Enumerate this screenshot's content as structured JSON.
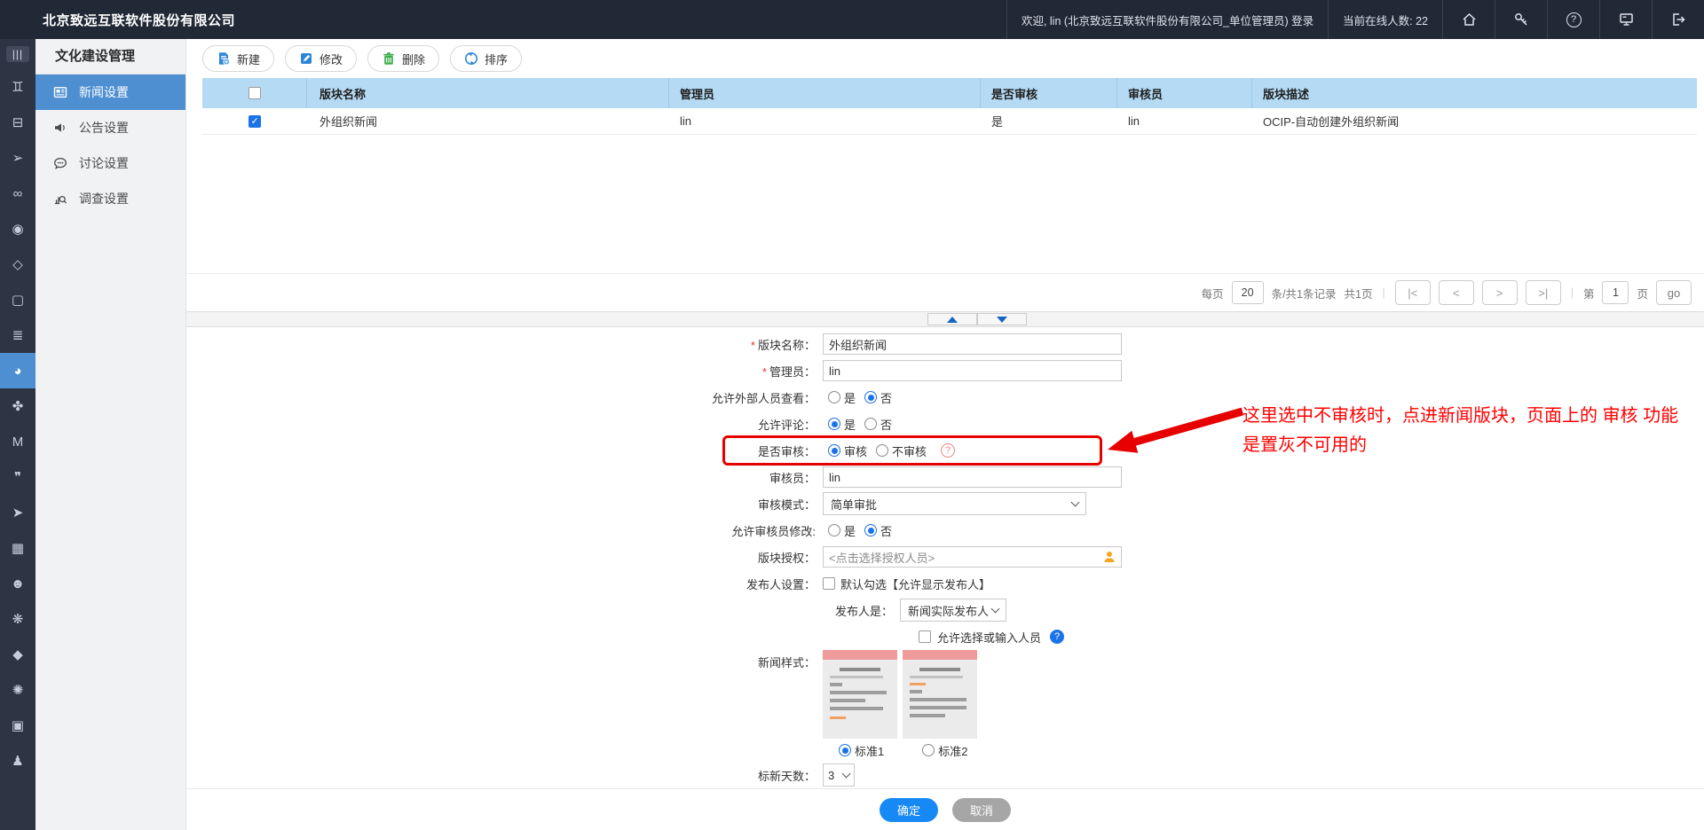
{
  "colors": {
    "accent_blue": "#1a73e8",
    "selected_blue": "#4e8fd2",
    "topbar_bg": "#212836",
    "table_header_bg": "#b5daf3",
    "annotation_red": "#ff0000",
    "delete_green": "#3eae4f",
    "person_orange": "#f5a623"
  },
  "header": {
    "company": "北京致远互联软件股份有限公司",
    "welcome": "欢迎, lin (北京致远互联软件股份有限公司_单位管理员) 登录",
    "online": "当前在线人数: 22"
  },
  "rail": [
    {
      "name": "menu-columns",
      "glyph": "|||"
    },
    {
      "name": "org-chart",
      "glyph": "♊"
    },
    {
      "name": "id-card",
      "glyph": "⊟"
    },
    {
      "name": "cursor",
      "glyph": "➢"
    },
    {
      "name": "workflow",
      "glyph": "∞"
    },
    {
      "name": "cap-badge",
      "glyph": "◉"
    },
    {
      "name": "cube-outline",
      "glyph": "◇"
    },
    {
      "name": "document",
      "glyph": "▢"
    },
    {
      "name": "stack",
      "glyph": "≣"
    },
    {
      "name": "culture-fan",
      "glyph": "◕"
    },
    {
      "name": "app-clover",
      "glyph": "✤"
    },
    {
      "name": "letter-m",
      "glyph": "M"
    },
    {
      "name": "chat-bubbles",
      "glyph": "❞"
    },
    {
      "name": "paper-plane",
      "glyph": "➤"
    },
    {
      "name": "bar-chart",
      "glyph": "▦"
    },
    {
      "name": "robot",
      "glyph": "☻"
    },
    {
      "name": "hex-flower",
      "glyph": "❋"
    },
    {
      "name": "cube",
      "glyph": "◆"
    },
    {
      "name": "gear",
      "glyph": "✺"
    },
    {
      "name": "terminal",
      "glyph": "▣"
    },
    {
      "name": "person",
      "glyph": "♟"
    }
  ],
  "sidebar": {
    "title": "文化建设管理",
    "items": [
      {
        "label": "新闻设置",
        "active": true
      },
      {
        "label": "公告设置",
        "active": false
      },
      {
        "label": "讨论设置",
        "active": false
      },
      {
        "label": "调查设置",
        "active": false
      }
    ]
  },
  "toolbar": {
    "buttons": [
      {
        "label": "新建"
      },
      {
        "label": "修改"
      },
      {
        "label": "删除"
      },
      {
        "label": "排序"
      }
    ]
  },
  "table": {
    "headers": [
      "版块名称",
      "管理员",
      "是否审核",
      "审核员",
      "版块描述"
    ],
    "rows": [
      {
        "checked": true,
        "name": "外组织新闻",
        "admin": "lin",
        "audited": "是",
        "auditor": "lin",
        "description": "OCIP-自动创建外组织新闻"
      }
    ]
  },
  "pagination": {
    "per_page_label": "每页",
    "per_page_value": "20",
    "records_label": "条/共1条记录",
    "total_pages_label": "共1页",
    "first": "|<",
    "prev": "<",
    "next": ">",
    "last": ">|",
    "page_prefix": "第",
    "page_value": "1",
    "page_suffix": "页",
    "go_label": "go"
  },
  "form": {
    "required_mark": "*",
    "fields": {
      "name": {
        "label": "版块名称：",
        "value": "外组织新闻"
      },
      "admin": {
        "label": "管理员：",
        "value": "lin"
      },
      "external_view": {
        "label": "允许外部人员查看：",
        "yes": "是",
        "no": "否",
        "selected": "否"
      },
      "comments": {
        "label": "允许评论：",
        "yes": "是",
        "no": "否",
        "selected": "是"
      },
      "audit": {
        "label": "是否审核：",
        "opt1": "审核",
        "opt2": "不审核",
        "selected": "审核"
      },
      "auditor": {
        "label": "审核员：",
        "value": "lin"
      },
      "audit_mode": {
        "label": "审核模式：",
        "value": "简单审批"
      },
      "auditor_modify": {
        "label": "允许审核员修改:",
        "yes": "是",
        "no": "否",
        "selected": "否"
      },
      "authorize": {
        "label": "版块授权：",
        "placeholder": "<点击选择授权人员>"
      },
      "publisher_setting": {
        "label": "发布人设置：",
        "checkbox_label": "默认勾选【允许显示发布人】",
        "checked": false
      },
      "publisher_is": {
        "label": "发布人是：",
        "value": "新闻实际发布人"
      },
      "allow_input": {
        "label": "允许选择或输入人员",
        "checked": false
      },
      "news_style": {
        "label": "新闻样式：",
        "opt1": "标准1",
        "opt2": "标准2",
        "selected": "标准1"
      },
      "new_days": {
        "label": "标新天数：",
        "value": "3"
      }
    }
  },
  "annotation": {
    "text": "这里选中不审核时，点进新闻版块，页面上的 审核 功能 是置灰不可用的"
  },
  "footer": {
    "ok": "确定",
    "cancel": "取消"
  }
}
